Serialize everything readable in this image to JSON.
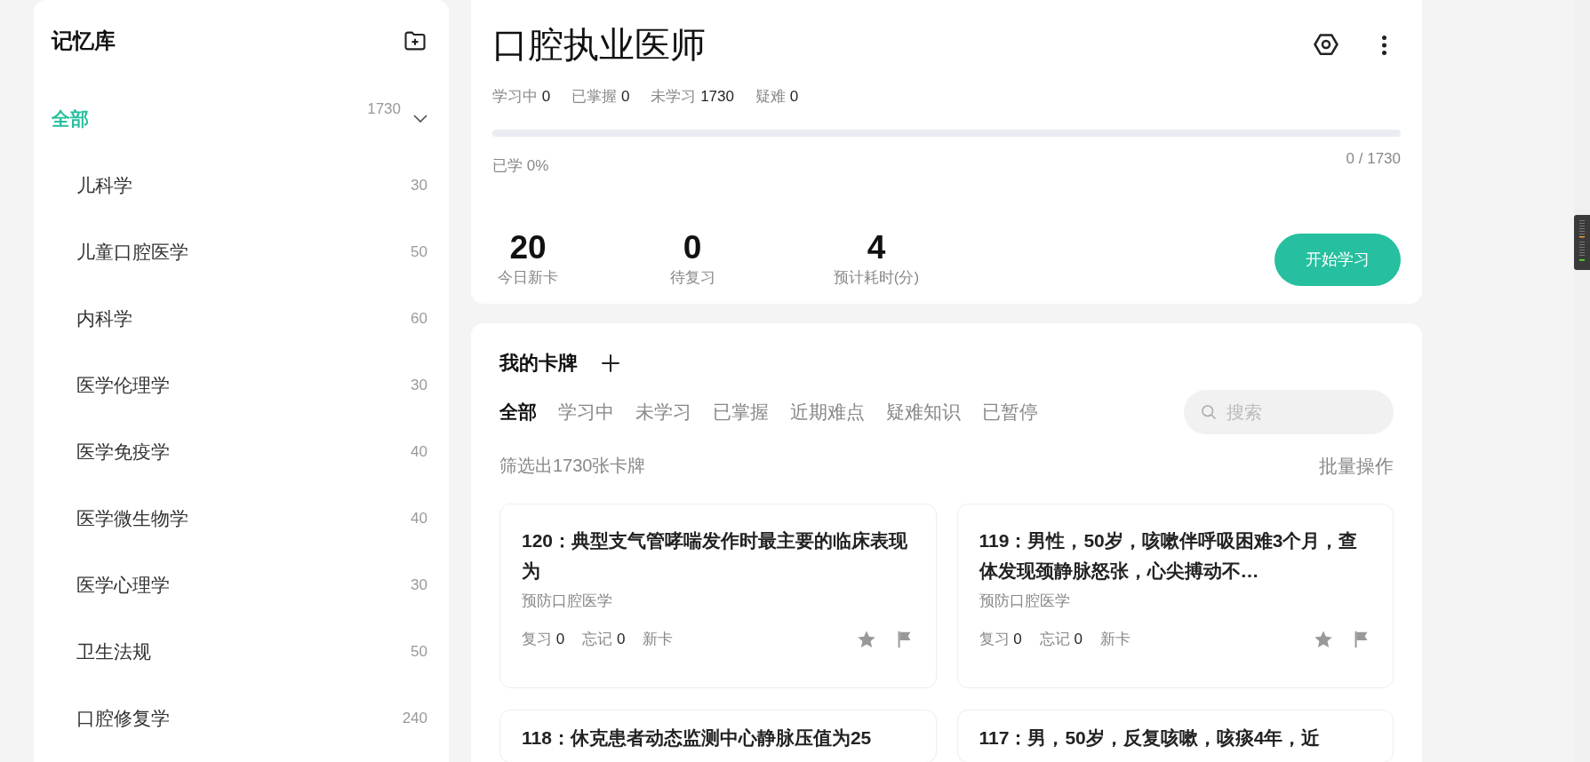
{
  "sidebar": {
    "title": "记忆库",
    "items": [
      {
        "label": "全部",
        "count": "1730",
        "selected": true,
        "expanded": true,
        "children": [
          {
            "label": "儿科学",
            "count": "30",
            "selected": false
          },
          {
            "label": "儿童口腔医学",
            "count": "50",
            "selected": false
          },
          {
            "label": "内科学",
            "count": "60",
            "selected": false
          },
          {
            "label": "医学伦理学",
            "count": "30",
            "selected": false
          },
          {
            "label": "医学免疫学",
            "count": "40",
            "selected": false
          },
          {
            "label": "医学微生物学",
            "count": "40",
            "selected": false
          },
          {
            "label": "医学心理学",
            "count": "30",
            "selected": false
          },
          {
            "label": "卫生法规",
            "count": "50",
            "selected": false
          },
          {
            "label": "口腔修复学",
            "count": "240",
            "selected": false
          }
        ]
      }
    ]
  },
  "deck": {
    "title": "口腔执业医师",
    "stats": [
      {
        "label": "学习中",
        "value": "0"
      },
      {
        "label": "已掌握",
        "value": "0"
      },
      {
        "label": "未学习",
        "value": "1730"
      },
      {
        "label": "疑难",
        "value": "0"
      }
    ],
    "progress": {
      "level": 0,
      "caption": "已学 0%",
      "count": "0 / 1730"
    },
    "metrics": [
      {
        "value": "20",
        "label": "今日新卡"
      },
      {
        "value": "0",
        "label": "待复习"
      },
      {
        "value": "4",
        "label": "预计耗时(分)"
      }
    ],
    "start_button": "开始学习"
  },
  "cards_panel": {
    "title": "我的卡牌",
    "tabs": [
      {
        "label": "全部",
        "selected": true
      },
      {
        "label": "学习中",
        "selected": false
      },
      {
        "label": "未学习",
        "selected": false
      },
      {
        "label": "已掌握",
        "selected": false
      },
      {
        "label": "近期难点",
        "selected": false
      },
      {
        "label": "疑难知识",
        "selected": false
      },
      {
        "label": "已暂停",
        "selected": false
      }
    ],
    "search": {
      "placeholder": "搜索"
    },
    "filter_text": "筛选出1730张卡牌",
    "batch_action": "批量操作",
    "cards": [
      {
        "title": "120：典型支气管哮喘发作时最主要的临床表现为",
        "deck": "预防口腔医学",
        "stats": [
          {
            "label": "复习",
            "value": "0"
          },
          {
            "label": "忘记",
            "value": "0"
          }
        ],
        "tag": "新卡"
      },
      {
        "title": "119：男性，50岁，咳嗽伴呼吸困难3个月，查体发现颈静脉怒张，心尖搏动不…",
        "deck": "预防口腔医学",
        "stats": [
          {
            "label": "复习",
            "value": "0"
          },
          {
            "label": "忘记",
            "value": "0"
          }
        ],
        "tag": "新卡"
      },
      {
        "title": "118：休克患者动态监测中心静脉压值为25"
      },
      {
        "title": "117：男，50岁，反复咳嗽，咳痰4年，近"
      }
    ]
  }
}
